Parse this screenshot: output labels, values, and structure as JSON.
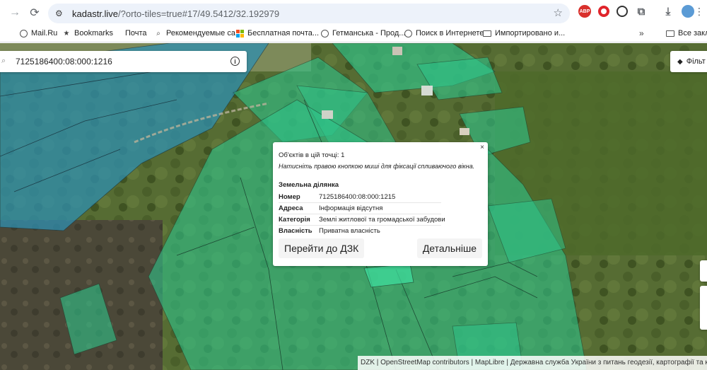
{
  "browser": {
    "url_host": "kadastr.live",
    "url_path": "/?orto-tiles=true#17/49.5412/32.192979",
    "extensions": {
      "abp_label": "ABP"
    }
  },
  "bookmarks": [
    {
      "label": "Mail.Ru",
      "icon": "globe-icon"
    },
    {
      "label": "Bookmarks",
      "icon": "star-icon"
    },
    {
      "label": "Почта",
      "icon": "mail-icon"
    },
    {
      "label": "Рекомендуемые са...",
      "icon": "search-icon"
    },
    {
      "label": "Бесплатная почта...",
      "icon": "microsoft-icon"
    },
    {
      "label": "Гетманська - Прод...",
      "icon": "globe-icon"
    },
    {
      "label": "Поиск в Интернете",
      "icon": "globe-icon"
    },
    {
      "label": "Импортировано и...",
      "icon": "folder-icon"
    },
    {
      "label": "Все заклад",
      "icon": "folder-icon"
    }
  ],
  "search": {
    "value": "7125186400:08:000:1216"
  },
  "filter": {
    "label": "Фільт"
  },
  "popup": {
    "count": "Об'єктів в цій точці: 1",
    "hint": "Натисніть правою кнопкою миші для фіксації спливаючого вікна.",
    "section": "Земельна ділянка",
    "rows": [
      {
        "key": "Номер",
        "value": "7125186400:08:000:1215"
      },
      {
        "key": "Адреса",
        "value": "Інформація відсутня"
      },
      {
        "key": "Категорія",
        "value": "Землі житлової та громадської забудови"
      },
      {
        "key": "Власність",
        "value": "Приватна власність"
      }
    ],
    "btn_dzk": "Перейти до ДЗК",
    "btn_details": "Детальніше",
    "close": "×"
  },
  "attribution": "DZK | OpenStreetMap contributors | MapLibre | Державна служба України з питань геодезії, картографії та кадастру",
  "colors": {
    "parcel_green": "#2fc48a",
    "parcel_blue": "#2f8fb0",
    "terrain": "#5b6e3a"
  }
}
